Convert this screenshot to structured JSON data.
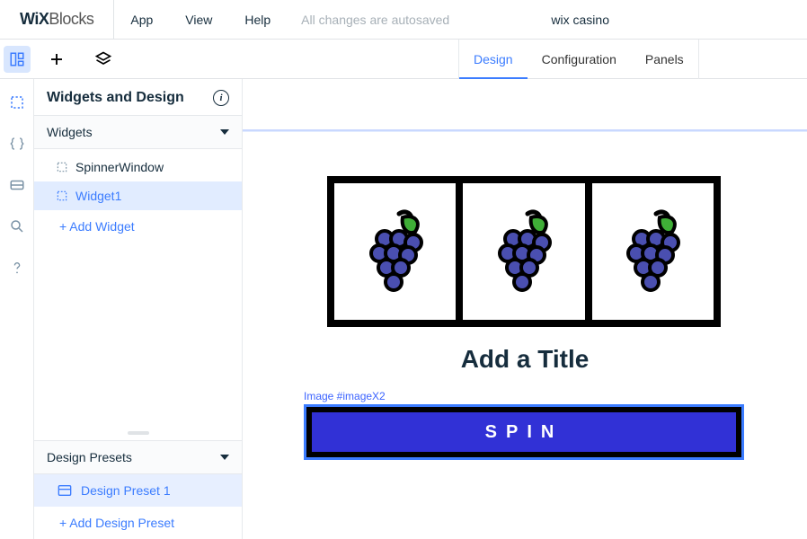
{
  "logo": {
    "strong": "WiX",
    "light": "Blocks"
  },
  "menu": {
    "app": "App",
    "view": "View",
    "help": "Help"
  },
  "autosave_text": "All changes are autosaved",
  "project_name": "wix casino",
  "tabs": {
    "design": "Design",
    "configuration": "Configuration",
    "panels": "Panels"
  },
  "sidepanel": {
    "title": "Widgets and Design",
    "widgets_header": "Widgets",
    "widgets": [
      {
        "label": "SpinnerWindow"
      },
      {
        "label": "Widget1"
      }
    ],
    "add_widget": "+ Add Widget",
    "presets_header": "Design Presets",
    "presets": [
      {
        "label": "Design Preset 1"
      }
    ],
    "add_preset": "+ Add Design Preset"
  },
  "canvas": {
    "title_placeholder": "Add a Title",
    "selection_label": "Image #imageX2",
    "spin_label": "SPIN"
  }
}
